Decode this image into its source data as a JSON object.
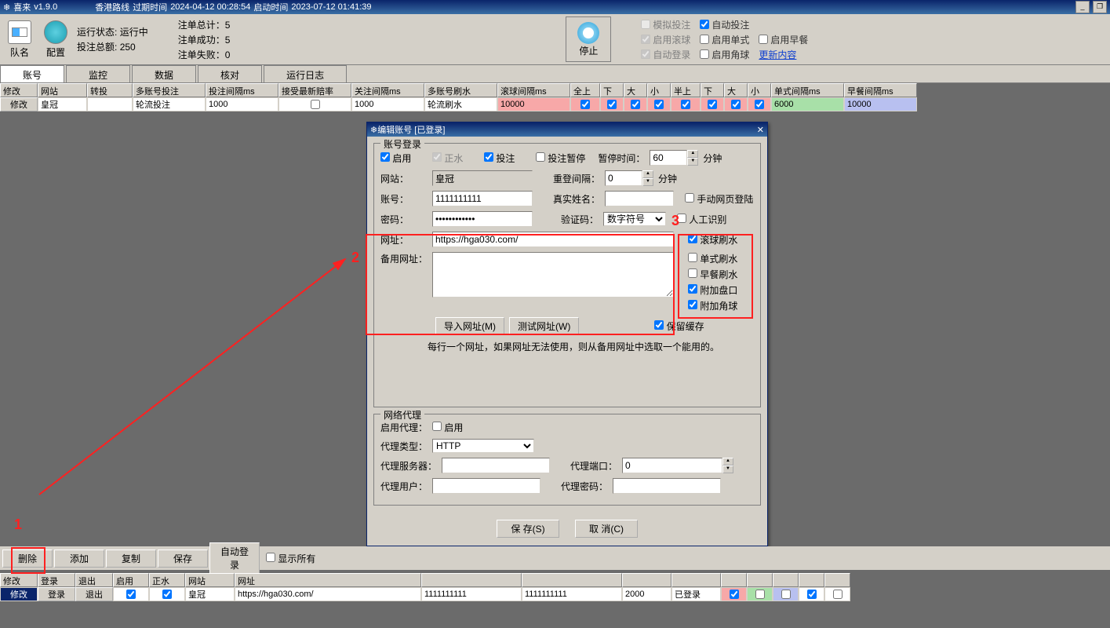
{
  "title": {
    "app": "喜来",
    "ver": "v1.9.0",
    "route": "香港路线",
    "expire_lbl": "过期时间",
    "expire": "2024-04-12 00:28:54",
    "start_lbl": "启动时间",
    "start": "2023-07-12 01:41:39"
  },
  "toolbar": {
    "team": "队名",
    "config": "配置",
    "status_lbl": "运行状态:",
    "status": "运行中",
    "bet_total_lbl": "投注总额:",
    "bet_total": "250",
    "order_total": "注单总计：5",
    "order_ok": "注单成功：5",
    "order_fail": "注单失败：0",
    "stop": "停止",
    "chk_sim": "模拟投注",
    "chk_auto_bet": "自动投注",
    "chk_roll": "启用滚球",
    "chk_single": "启用单式",
    "chk_breakfast": "启用早餐",
    "chk_auto_login": "自动登录",
    "chk_corner": "启用角球",
    "update": "更新内容"
  },
  "tabs": [
    "账号",
    "监控",
    "数据",
    "核对",
    "运行日志"
  ],
  "grid1": {
    "headers": [
      "修改",
      "网站",
      "转投",
      "多账号投注",
      "投注间隔ms",
      "接受最新赔率",
      "关注间隔ms",
      "多账号刷水",
      "滚球间隔ms",
      "全上",
      "下",
      "大",
      "小",
      "半上",
      "下",
      "大",
      "小",
      "单式间隔ms",
      "早餐间隔ms"
    ],
    "row": {
      "edit": "修改",
      "site": "皇冠",
      "multi": "轮流投注",
      "bet_int": "1000",
      "watch_int": "1000",
      "shuishui": "轮流刷水",
      "roll_int": "10000",
      "single_int": "6000",
      "bf_int": "10000"
    }
  },
  "dlg": {
    "title": "编辑账号 [已登录]",
    "fs1": "账号登录",
    "enable": "启用",
    "water": "正水",
    "bet": "投注",
    "pause": "投注暂停",
    "pause_time": "暂停时间：",
    "min": "分钟",
    "pause_val": "60",
    "site_lbl": "网站：",
    "site": "皇冠",
    "relogin": "重登间隔：",
    "relogin_val": "0",
    "acct_lbl": "账号：",
    "acct": "1111111111",
    "realname": "真实姓名：",
    "pwd_lbl": "密码：",
    "pwd": "************",
    "captcha": "验证码：",
    "captcha_type": "数字符号",
    "url_lbl": "网址：",
    "url": "https://hga030.com/",
    "backup_lbl": "备用网址：",
    "import_btn": "导入网址(M)",
    "test_btn": "测试网址(W)",
    "keep_cache": "保留缓存",
    "hint": "每行一个网址，如果网址无法使用，则从备用网址中选取一个能用的。",
    "chk_manual": "手动网页登陆",
    "chk_human": "人工识别",
    "chk_roll": "滚球刷水",
    "chk_single": "单式刷水",
    "chk_bf": "早餐刷水",
    "chk_pan": "附加盘口",
    "chk_corner": "附加角球",
    "fs2": "网络代理",
    "proxy_en": "启用代理：",
    "enable2": "启用",
    "proxy_type": "代理类型：",
    "http": "HTTP",
    "proxy_srv": "代理服务器：",
    "proxy_port": "代理端口：",
    "port_val": "0",
    "proxy_user": "代理用户：",
    "proxy_pwd": "代理密码：",
    "save": "保 存(S)",
    "cancel": "取 消(C)"
  },
  "bottom_btns": [
    "删除",
    "添加",
    "复制",
    "保存",
    "自动登录"
  ],
  "show_all": "显示所有",
  "grid2": {
    "headers": [
      "修改",
      "登录",
      "退出",
      "启用",
      "正水",
      "网站",
      "网址"
    ],
    "row": {
      "edit": "修改",
      "login": "登录",
      "logout": "退出",
      "site": "皇冠",
      "url": "https://hga030.com/",
      "c1": "1111111111",
      "c2": "1111111111",
      "c3": "2000",
      "c4": "已登录"
    }
  },
  "labels": {
    "l1": "1",
    "l2": "2",
    "l3": "3"
  }
}
